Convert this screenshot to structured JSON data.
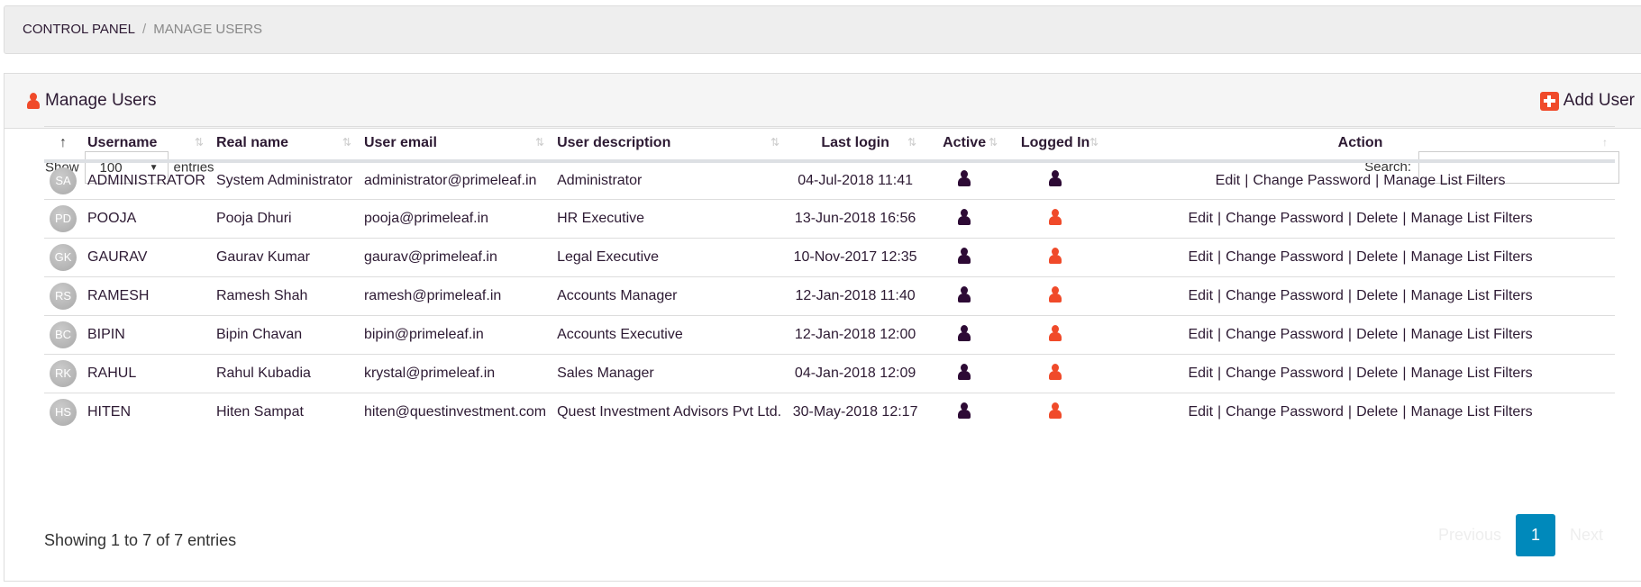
{
  "breadcrumb": {
    "items": [
      "CONTROL PANEL",
      "MANAGE USERS"
    ],
    "separator": "/"
  },
  "panel": {
    "title": "Manage Users",
    "add_label": "Add User"
  },
  "controls": {
    "show_label": "Show",
    "page_size": "100",
    "entries_label": "entries",
    "search_label": "Search:",
    "search_value": ""
  },
  "table": {
    "columns": [
      "Username",
      "Real name",
      "User email",
      "User description",
      "Last login",
      "Active",
      "Logged In",
      "Action"
    ],
    "rows": [
      {
        "initials": "SA",
        "username": "ADMINISTRATOR",
        "real_name": "System Administrator",
        "email": "administrator@primeleaf.in",
        "description": "Administrator",
        "last_login": "04-Jul-2018 11:41",
        "active": true,
        "logged_in": true,
        "actions": [
          "Edit",
          "Change Password",
          "Manage List Filters"
        ]
      },
      {
        "initials": "PD",
        "username": "POOJA",
        "real_name": "Pooja Dhuri",
        "email": "pooja@primeleaf.in",
        "description": "HR Executive",
        "last_login": "13-Jun-2018 16:56",
        "active": true,
        "logged_in": false,
        "actions": [
          "Edit",
          "Change Password",
          "Delete",
          "Manage List Filters"
        ]
      },
      {
        "initials": "GK",
        "username": "GAURAV",
        "real_name": "Gaurav Kumar",
        "email": "gaurav@primeleaf.in",
        "description": "Legal Executive",
        "last_login": "10-Nov-2017 12:35",
        "active": true,
        "logged_in": false,
        "actions": [
          "Edit",
          "Change Password",
          "Delete",
          "Manage List Filters"
        ]
      },
      {
        "initials": "RS",
        "username": "RAMESH",
        "real_name": "Ramesh Shah",
        "email": "ramesh@primeleaf.in",
        "description": "Accounts Manager",
        "last_login": "12-Jan-2018 11:40",
        "active": true,
        "logged_in": false,
        "actions": [
          "Edit",
          "Change Password",
          "Delete",
          "Manage List Filters"
        ]
      },
      {
        "initials": "BC",
        "username": "BIPIN",
        "real_name": "Bipin Chavan",
        "email": "bipin@primeleaf.in",
        "description": "Accounts Executive",
        "last_login": "12-Jan-2018 12:00",
        "active": true,
        "logged_in": false,
        "actions": [
          "Edit",
          "Change Password",
          "Delete",
          "Manage List Filters"
        ]
      },
      {
        "initials": "RK",
        "username": "RAHUL",
        "real_name": "Rahul Kubadia",
        "email": "krystal@primeleaf.in",
        "description": "Sales Manager",
        "last_login": "04-Jan-2018 12:09",
        "active": true,
        "logged_in": false,
        "actions": [
          "Edit",
          "Change Password",
          "Delete",
          "Manage List Filters"
        ]
      },
      {
        "initials": "HS",
        "username": "HITEN",
        "real_name": "Hiten Sampat",
        "email": "hiten@questinvestment.com",
        "description": "Quest Investment Advisors Pvt Ltd.",
        "last_login": "30-May-2018 12:17",
        "active": true,
        "logged_in": false,
        "actions": [
          "Edit",
          "Change Password",
          "Delete",
          "Manage List Filters"
        ]
      }
    ]
  },
  "footer": {
    "info": "Showing 1 to 7 of 7 entries",
    "previous": "Previous",
    "page": "1",
    "next": "Next"
  },
  "colors": {
    "on": "#2d0a35",
    "off": "#f04a2a",
    "accent": "#0089bb"
  }
}
